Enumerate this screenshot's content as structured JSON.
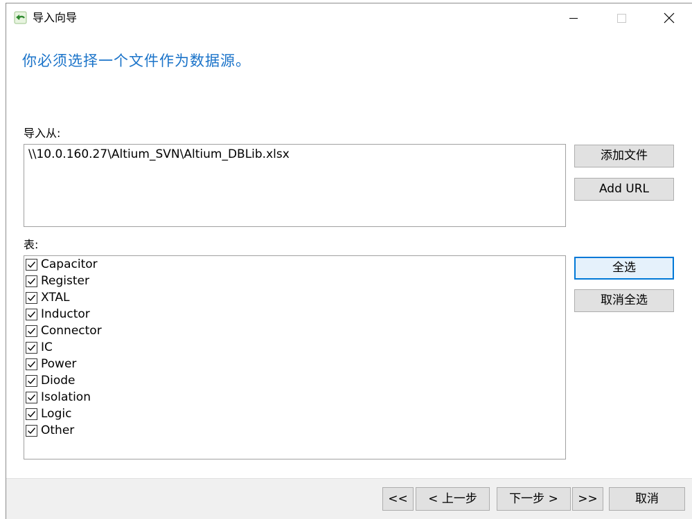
{
  "window": {
    "title": "导入向导",
    "minimize_icon": "minimize-icon",
    "maximize_icon": "maximize-icon",
    "close_icon": "close-icon"
  },
  "heading": "你必须选择一个文件作为数据源。",
  "import_from": {
    "label": "导入从:",
    "path": "\\\\10.0.160.27\\Altium_SVN\\Altium_DBLib.xlsx",
    "add_file_label": "添加文件",
    "add_url_label": "Add URL"
  },
  "tables": {
    "label": "表:",
    "items": [
      {
        "name": "Capacitor",
        "checked": true
      },
      {
        "name": "Register",
        "checked": true
      },
      {
        "name": "XTAL",
        "checked": true
      },
      {
        "name": "Inductor",
        "checked": true
      },
      {
        "name": "Connector",
        "checked": true
      },
      {
        "name": "IC",
        "checked": true
      },
      {
        "name": "Power",
        "checked": true
      },
      {
        "name": "Diode",
        "checked": true
      },
      {
        "name": "Isolation",
        "checked": true
      },
      {
        "name": "Logic",
        "checked": true
      },
      {
        "name": "Other",
        "checked": true
      }
    ],
    "select_all_label": "全选",
    "deselect_all_label": "取消全选"
  },
  "footer": {
    "first_label": "<<",
    "prev_label": "< 上一步",
    "next_label": "下一步 >",
    "last_label": ">>",
    "cancel_label": "取消"
  }
}
